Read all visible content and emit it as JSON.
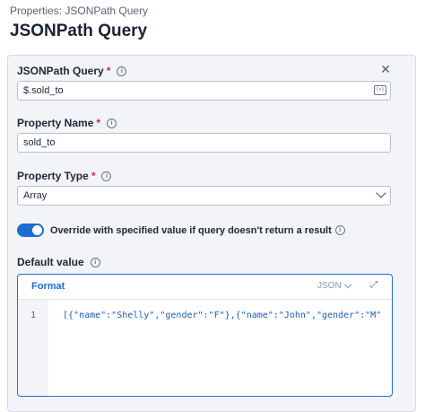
{
  "header": {
    "breadcrumb": "Properties: JSONPath Query",
    "title": "JSONPath Query"
  },
  "form": {
    "jsonpath": {
      "label": "JSONPath Query",
      "required_mark": "*",
      "value": "$.sold_to",
      "icon": "code-field-icon"
    },
    "property_name": {
      "label": "Property Name",
      "required_mark": "*",
      "value": "sold_to"
    },
    "property_type": {
      "label": "Property Type",
      "required_mark": "*",
      "value": "Array"
    },
    "override": {
      "enabled": true,
      "label": "Override with specified value if query doesn't return a result"
    },
    "default_value": {
      "label": "Default value",
      "format_label": "Format",
      "language": "JSON",
      "line_number": "1",
      "code": "[{\"name\":\"Shelly\",\"gender\":\"F\"},{\"name\":\"John\",\"gender\":\"M\""
    }
  },
  "colors": {
    "accent": "#1c6ed4",
    "required": "#d9263e",
    "panel_bg": "#f2f4f8"
  }
}
